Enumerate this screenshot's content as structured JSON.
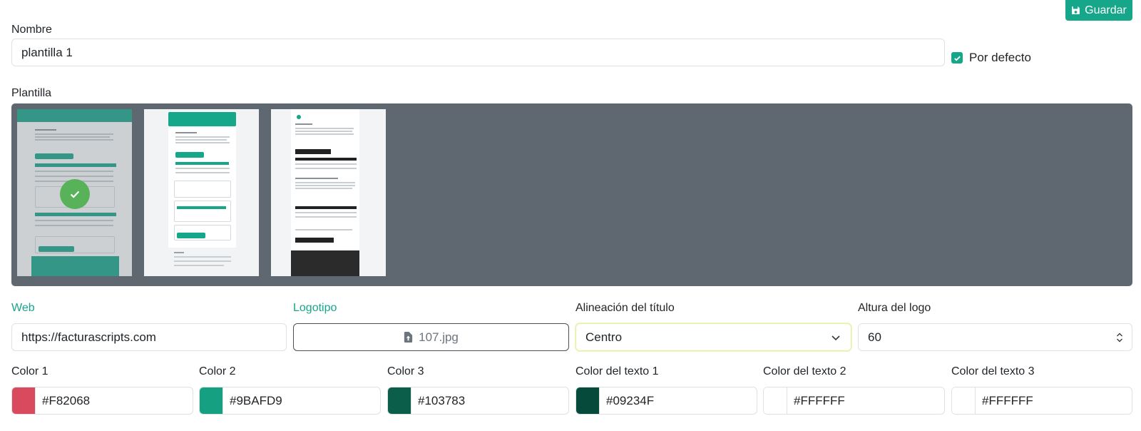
{
  "toolbar": {
    "save_label": "Guardar"
  },
  "form": {
    "name_label": "Nombre",
    "name_value": "plantilla 1",
    "default_label": "Por defecto",
    "default_checked": true,
    "template_label": "Plantilla",
    "templates": [
      {
        "selected": true
      },
      {
        "selected": false
      },
      {
        "selected": false
      }
    ],
    "web_label": "Web",
    "web_value": "https://facturascripts.com",
    "logo_label": "Logotipo",
    "logo_file": "107.jpg",
    "title_align_label": "Alineación del título",
    "title_align_value": "Centro",
    "logo_height_label": "Altura del logo",
    "logo_height_value": "60",
    "colors": [
      {
        "label": "Color 1",
        "value": "#F82068",
        "swatch": "#d94a5f"
      },
      {
        "label": "Color 2",
        "value": "#9BAFD9",
        "swatch": "#16a082"
      },
      {
        "label": "Color 3",
        "value": "#103783",
        "swatch": "#0b5e4a"
      },
      {
        "label": "Color del texto 1",
        "value": "#09234F",
        "swatch": "#064a3b"
      },
      {
        "label": "Color del texto 2",
        "value": "#FFFFFF",
        "swatch": "#ffffff"
      },
      {
        "label": "Color del texto 3",
        "value": "#FFFFFF",
        "swatch": "#ffffff"
      }
    ]
  },
  "colors": {
    "accent": "#16a68a",
    "gallery_bg": "#5f6771",
    "check": "#58b25a"
  }
}
